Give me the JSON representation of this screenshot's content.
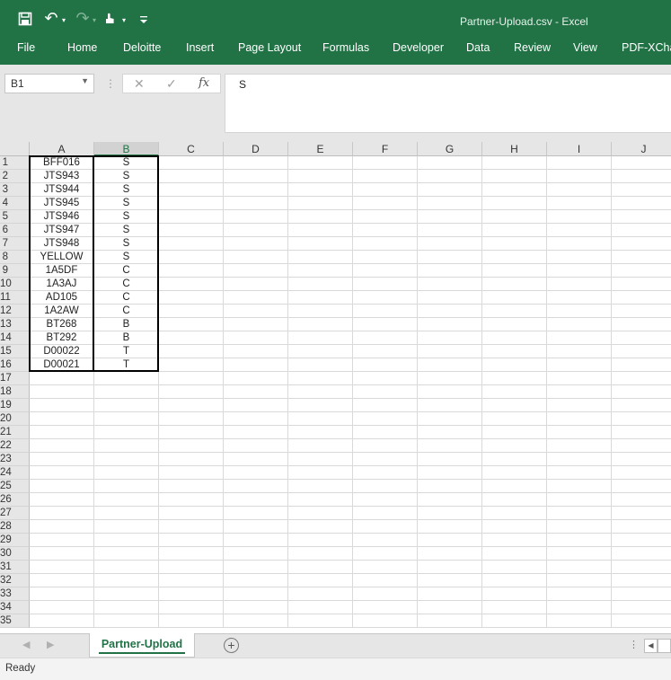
{
  "window": {
    "title": "Partner-Upload.csv - Excel"
  },
  "qat": {
    "undo_glyph": "↶",
    "redo_glyph": "↷",
    "touch_glyph": "☚",
    "customize_glyph": "⌄"
  },
  "ribbon": {
    "tabs": [
      {
        "label": "File"
      },
      {
        "label": "Home"
      },
      {
        "label": "Deloitte"
      },
      {
        "label": "Insert"
      },
      {
        "label": "Page Layout"
      },
      {
        "label": "Formulas"
      },
      {
        "label": "Developer"
      },
      {
        "label": "Data"
      },
      {
        "label": "Review"
      },
      {
        "label": "View"
      },
      {
        "label": "PDF-XCha"
      }
    ]
  },
  "formula_bar": {
    "name_box": "B1",
    "cancel_glyph": "✕",
    "enter_glyph": "✓",
    "fx_label": "fx",
    "content": "S"
  },
  "grid": {
    "columns": [
      "A",
      "B",
      "C",
      "D",
      "E",
      "F",
      "G",
      "H",
      "I",
      "J"
    ],
    "selected_column": "B",
    "rows": [
      "1",
      "2",
      "3",
      "4",
      "5",
      "6",
      "7",
      "8",
      "9",
      "10",
      "11",
      "12",
      "13",
      "14",
      "15",
      "16",
      "17",
      "18",
      "19",
      "20",
      "21",
      "22",
      "23",
      "24",
      "25",
      "26",
      "27",
      "28",
      "29",
      "30",
      "31",
      "32",
      "33",
      "34",
      "35"
    ],
    "data": [
      [
        "BFF016",
        "S"
      ],
      [
        "JTS943",
        "S"
      ],
      [
        "JTS944",
        "S"
      ],
      [
        "JTS945",
        "S"
      ],
      [
        "JTS946",
        "S"
      ],
      [
        "JTS947",
        "S"
      ],
      [
        "JTS948",
        "S"
      ],
      [
        "YELLOW",
        "S"
      ],
      [
        "1A5DF",
        "C"
      ],
      [
        "1A3AJ",
        "C"
      ],
      [
        "AD105",
        "C"
      ],
      [
        "1A2AW",
        "C"
      ],
      [
        "BT268",
        "B"
      ],
      [
        "BT292",
        "B"
      ],
      [
        "D00022",
        "T"
      ],
      [
        "D00021",
        "T"
      ]
    ]
  },
  "sheet_tabs": {
    "active": "Partner-Upload",
    "add_glyph": "+",
    "nav_prev": "◀",
    "nav_next": "▶",
    "dots": "⋮",
    "scroll_left": "◀"
  },
  "status": {
    "text": "Ready"
  },
  "colors": {
    "accent": "#217346",
    "header_bg": "#e6e6e6",
    "gridline": "#d9d9d9"
  }
}
